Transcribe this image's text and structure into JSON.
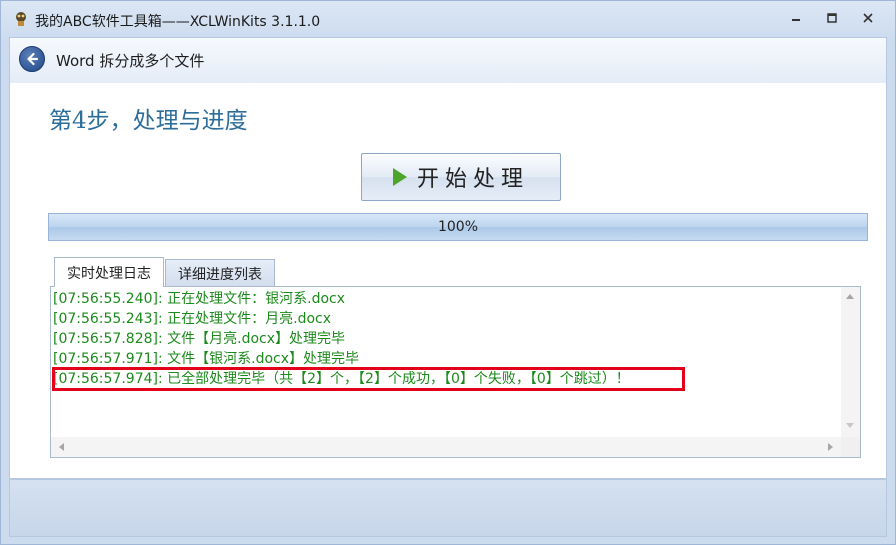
{
  "window": {
    "title": "我的ABC软件工具箱——XCLWinKits  3.1.1.0",
    "icon": "app-mascot-icon",
    "controls": {
      "minimize_icon": "minimize-icon",
      "maximize_icon": "maximize-icon",
      "close_icon": "close-icon"
    }
  },
  "nav": {
    "back_icon": "back-arrow-icon",
    "title": "Word 拆分成多个文件"
  },
  "main": {
    "step_title": "第4步，处理与进度",
    "start_button": {
      "label": "开始处理",
      "icon": "play-icon"
    },
    "progress": {
      "value": 1.0,
      "label": "100%"
    },
    "tabs": [
      {
        "label": "实时处理日志",
        "active": true
      },
      {
        "label": "详细进度列表",
        "active": false
      }
    ],
    "log": [
      "[07:56:55.240]: 正在处理文件：银河系.docx",
      "[07:56:55.243]: 正在处理文件：月亮.docx",
      "[07:56:57.828]: 文件【月亮.docx】处理完毕",
      "[07:56:57.971]: 文件【银河系.docx】处理完毕",
      "[07:56:57.974]: 已全部处理完毕（共【2】个，【2】个成功，【0】个失败，【0】个跳过）！"
    ]
  },
  "colors": {
    "log_text": "#1c8a1c",
    "highlight": "#e3001b",
    "step_title": "#2c6d9a",
    "play": "#4ea52c"
  }
}
